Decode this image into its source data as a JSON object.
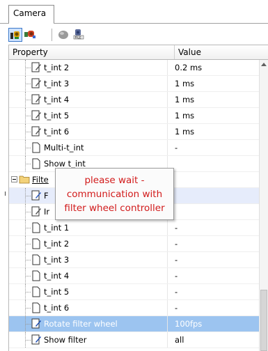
{
  "tab": {
    "label": "Camera"
  },
  "toolbar": {
    "buttons": [
      {
        "icon": "camera-sort-icon",
        "active": true
      },
      {
        "icon": "camera-color-icon",
        "active": false
      },
      {
        "icon": "gray-blob-icon",
        "active": false
      },
      {
        "icon": "camera-file-icon",
        "active": false
      }
    ]
  },
  "grid": {
    "header": {
      "property": "Property",
      "value": "Value"
    },
    "rows_top": [
      {
        "label": "t_int 2",
        "value": "0.2 ms",
        "icon": "edit-doc-icon"
      },
      {
        "label": "t_int 3",
        "value": "1 ms",
        "icon": "edit-doc-icon"
      },
      {
        "label": "t_int 4",
        "value": "1 ms",
        "icon": "edit-doc-icon"
      },
      {
        "label": "t_int 5",
        "value": "1 ms",
        "icon": "edit-doc-icon"
      },
      {
        "label": "t_int 6",
        "value": "1 ms",
        "icon": "edit-doc-icon"
      },
      {
        "label": "Multi-t_int",
        "value": "-",
        "icon": "doc-icon"
      },
      {
        "label": "Show t_int",
        "value": "",
        "icon": "doc-icon"
      }
    ],
    "folder": {
      "label": "Filte"
    },
    "row_f": {
      "label": "F",
      "value": ""
    },
    "row_i": {
      "label": "Ir",
      "value": ""
    },
    "rows_bottom": [
      {
        "label": "t_int 1",
        "value": "-"
      },
      {
        "label": "t_int 2",
        "value": "-"
      },
      {
        "label": "t_int 3",
        "value": "-"
      },
      {
        "label": "t_int 4",
        "value": "-"
      },
      {
        "label": "t_int 5",
        "value": "-"
      },
      {
        "label": "t_int 6",
        "value": "-"
      }
    ],
    "selected_row": {
      "label": "Rotate filter wheel",
      "value": "100fps"
    },
    "last_row": {
      "label": "Show filter",
      "value": "all"
    }
  },
  "popup": {
    "lines": [
      "please wait -",
      "communication with",
      "filter wheel controller"
    ]
  },
  "colors": {
    "selected_bg": "#9cc4f0",
    "popup_text": "#d21a1a"
  }
}
